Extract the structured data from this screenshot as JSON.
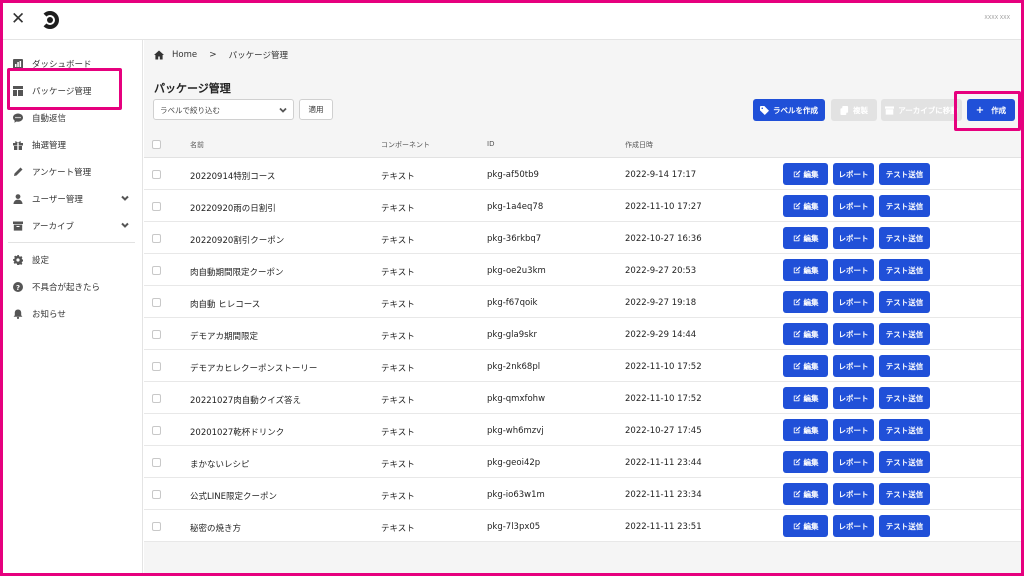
{
  "topbar": {
    "close_glyph": "✕",
    "logo_icon": "app-logo",
    "user_text": "XXXX XXX"
  },
  "sidebar": {
    "items": [
      {
        "label": "ダッシュボード",
        "icon": "dashboard-icon"
      },
      {
        "label": "パッケージ管理",
        "icon": "package-icon"
      },
      {
        "label": "自動返信",
        "icon": "chat-icon"
      },
      {
        "label": "抽選管理",
        "icon": "lottery-icon"
      },
      {
        "label": "アンケート管理",
        "icon": "survey-icon"
      },
      {
        "label": "ユーザー管理",
        "icon": "user-icon",
        "expandable": true
      },
      {
        "label": "アーカイブ",
        "icon": "archive-icon",
        "expandable": true
      },
      {
        "label": "設定",
        "icon": "gear-icon"
      },
      {
        "label": "不具合が起きたら",
        "icon": "help-icon"
      },
      {
        "label": "お知らせ",
        "icon": "bell-icon"
      }
    ]
  },
  "breadcrumb": {
    "home": "Home",
    "separator": ">",
    "current": "パッケージ管理"
  },
  "page": {
    "title": "パッケージ管理"
  },
  "filters": {
    "label_select": "ラベルで絞り込む",
    "apply": "適用"
  },
  "toolbar": {
    "label_create": "ラベルを作成",
    "copy": "複製",
    "archive": "アーカイブに移動",
    "create": "作成"
  },
  "table": {
    "headers": {
      "name": "名前",
      "component": "コンポーネント",
      "id": "ID",
      "created": "作成日時"
    },
    "actions": {
      "edit": "編集",
      "report": "レポート",
      "test_send": "テスト送信"
    },
    "rows": [
      {
        "name": "20220914特別コース",
        "component": "テキスト",
        "id": "pkg-af50tb9",
        "created": "2022-9-14 17:17"
      },
      {
        "name": "20220920雨の日割引",
        "component": "テキスト",
        "id": "pkg-1a4eq78",
        "created": "2022-11-10 17:27"
      },
      {
        "name": "20220920割引クーポン",
        "component": "テキスト",
        "id": "pkg-36rkbq7",
        "created": "2022-10-27 16:36"
      },
      {
        "name": "肉自動期間限定クーポン",
        "component": "テキスト",
        "id": "pkg-oe2u3km",
        "created": "2022-9-27 20:53"
      },
      {
        "name": "肉自動 ヒレコース",
        "component": "テキスト",
        "id": "pkg-f67qoik",
        "created": "2022-9-27 19:18"
      },
      {
        "name": "デモアカ期間限定",
        "component": "テキスト",
        "id": "pkg-gla9skr",
        "created": "2022-9-29 14:44"
      },
      {
        "name": "デモアカヒレクーポンストーリー",
        "component": "テキスト",
        "id": "pkg-2nk68pl",
        "created": "2022-11-10 17:52"
      },
      {
        "name": "20221027肉自動クイズ答え",
        "component": "テキスト",
        "id": "pkg-qmxfohw",
        "created": "2022-11-10 17:52"
      },
      {
        "name": "20201027乾杯ドリンク",
        "component": "テキスト",
        "id": "pkg-wh6mzvj",
        "created": "2022-10-27 17:45"
      },
      {
        "name": "まかないレシピ",
        "component": "テキスト",
        "id": "pkg-geoi42p",
        "created": "2022-11-11 23:44"
      },
      {
        "name": "公式LINE限定クーポン",
        "component": "テキスト",
        "id": "pkg-io63w1m",
        "created": "2022-11-11 23:34"
      },
      {
        "name": "秘密の焼き方",
        "component": "テキスト",
        "id": "pkg-7l3px05",
        "created": "2022-11-11 23:51"
      }
    ]
  },
  "colors": {
    "accent": "#2050d8",
    "highlight": "#e6007e",
    "disabled": "#e2e2e2"
  }
}
